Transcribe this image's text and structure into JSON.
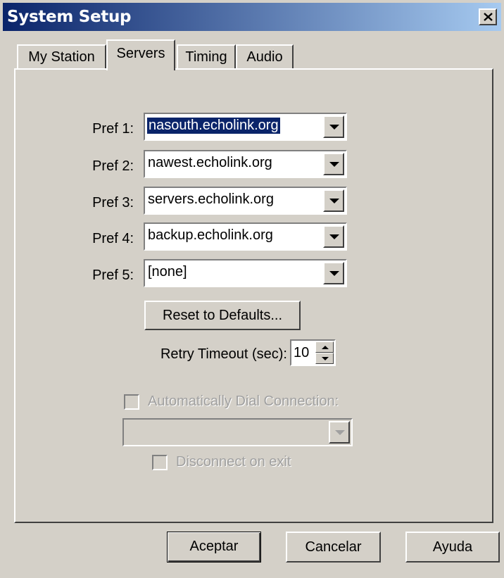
{
  "window": {
    "title": "System Setup"
  },
  "tabs": [
    "My Station",
    "Servers",
    "Timing",
    "Audio"
  ],
  "active_tab": "Servers",
  "servers": [
    {
      "label": "Pref 1:",
      "value": "nasouth.echolink.org"
    },
    {
      "label": "Pref 2:",
      "value": "nawest.echolink.org"
    },
    {
      "label": "Pref 3:",
      "value": "servers.echolink.org"
    },
    {
      "label": "Pref 4:",
      "value": "backup.echolink.org"
    },
    {
      "label": "Pref 5:",
      "value": "[none]"
    }
  ],
  "reset_label": "Reset to Defaults...",
  "retry": {
    "label": "Retry Timeout (sec):",
    "value": "10"
  },
  "auto_dial": {
    "label": "Automatically Dial Connection:",
    "checked": false,
    "enabled": false
  },
  "dial_combo": {
    "value": ""
  },
  "disconnect": {
    "label": "Disconnect on exit",
    "checked": false,
    "enabled": false
  },
  "buttons": {
    "ok": "Aceptar",
    "cancel": "Cancelar",
    "help": "Ayuda"
  },
  "colors": {
    "titlebar_start": "#0a246a",
    "titlebar_end": "#a6caf0",
    "face": "#d4d0c8",
    "selection": "#0a246a"
  }
}
